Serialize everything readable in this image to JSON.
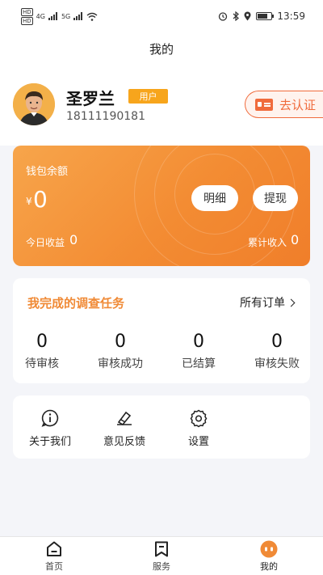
{
  "status_bar": {
    "left_badges": [
      "HD",
      "HD"
    ],
    "network": "4G",
    "network2": "5G",
    "time": "13:59"
  },
  "nav": {
    "title": "我的"
  },
  "profile": {
    "name": "圣罗兰",
    "role_badge": "用户",
    "phone": "18111190181",
    "verify_label": "去认证"
  },
  "wallet": {
    "label": "钱包余额",
    "currency": "¥",
    "balance": "0",
    "detail_button": "明细",
    "withdraw_button": "提现",
    "today_label": "今日收益",
    "today_value": "0",
    "total_label": "累计收入",
    "total_value": "0"
  },
  "tasks": {
    "title": "我完成的调查任务",
    "all_orders": "所有订单",
    "stats": [
      {
        "value": "0",
        "label": "待审核"
      },
      {
        "value": "0",
        "label": "审核成功"
      },
      {
        "value": "0",
        "label": "已结算"
      },
      {
        "value": "0",
        "label": "审核失败"
      }
    ]
  },
  "menu": {
    "items": [
      {
        "label": "关于我们",
        "icon": "info-icon"
      },
      {
        "label": "意见反馈",
        "icon": "feedback-icon"
      },
      {
        "label": "设置",
        "icon": "gear-icon"
      }
    ]
  },
  "tabbar": {
    "tabs": [
      {
        "label": "首页",
        "icon": "home-icon"
      },
      {
        "label": "服务",
        "icon": "bookmark-icon"
      },
      {
        "label": "我的",
        "icon": "profile-icon"
      }
    ]
  },
  "colors": {
    "accent": "#f08a36",
    "badge": "#f7a51c",
    "verify": "#f06b3c"
  }
}
